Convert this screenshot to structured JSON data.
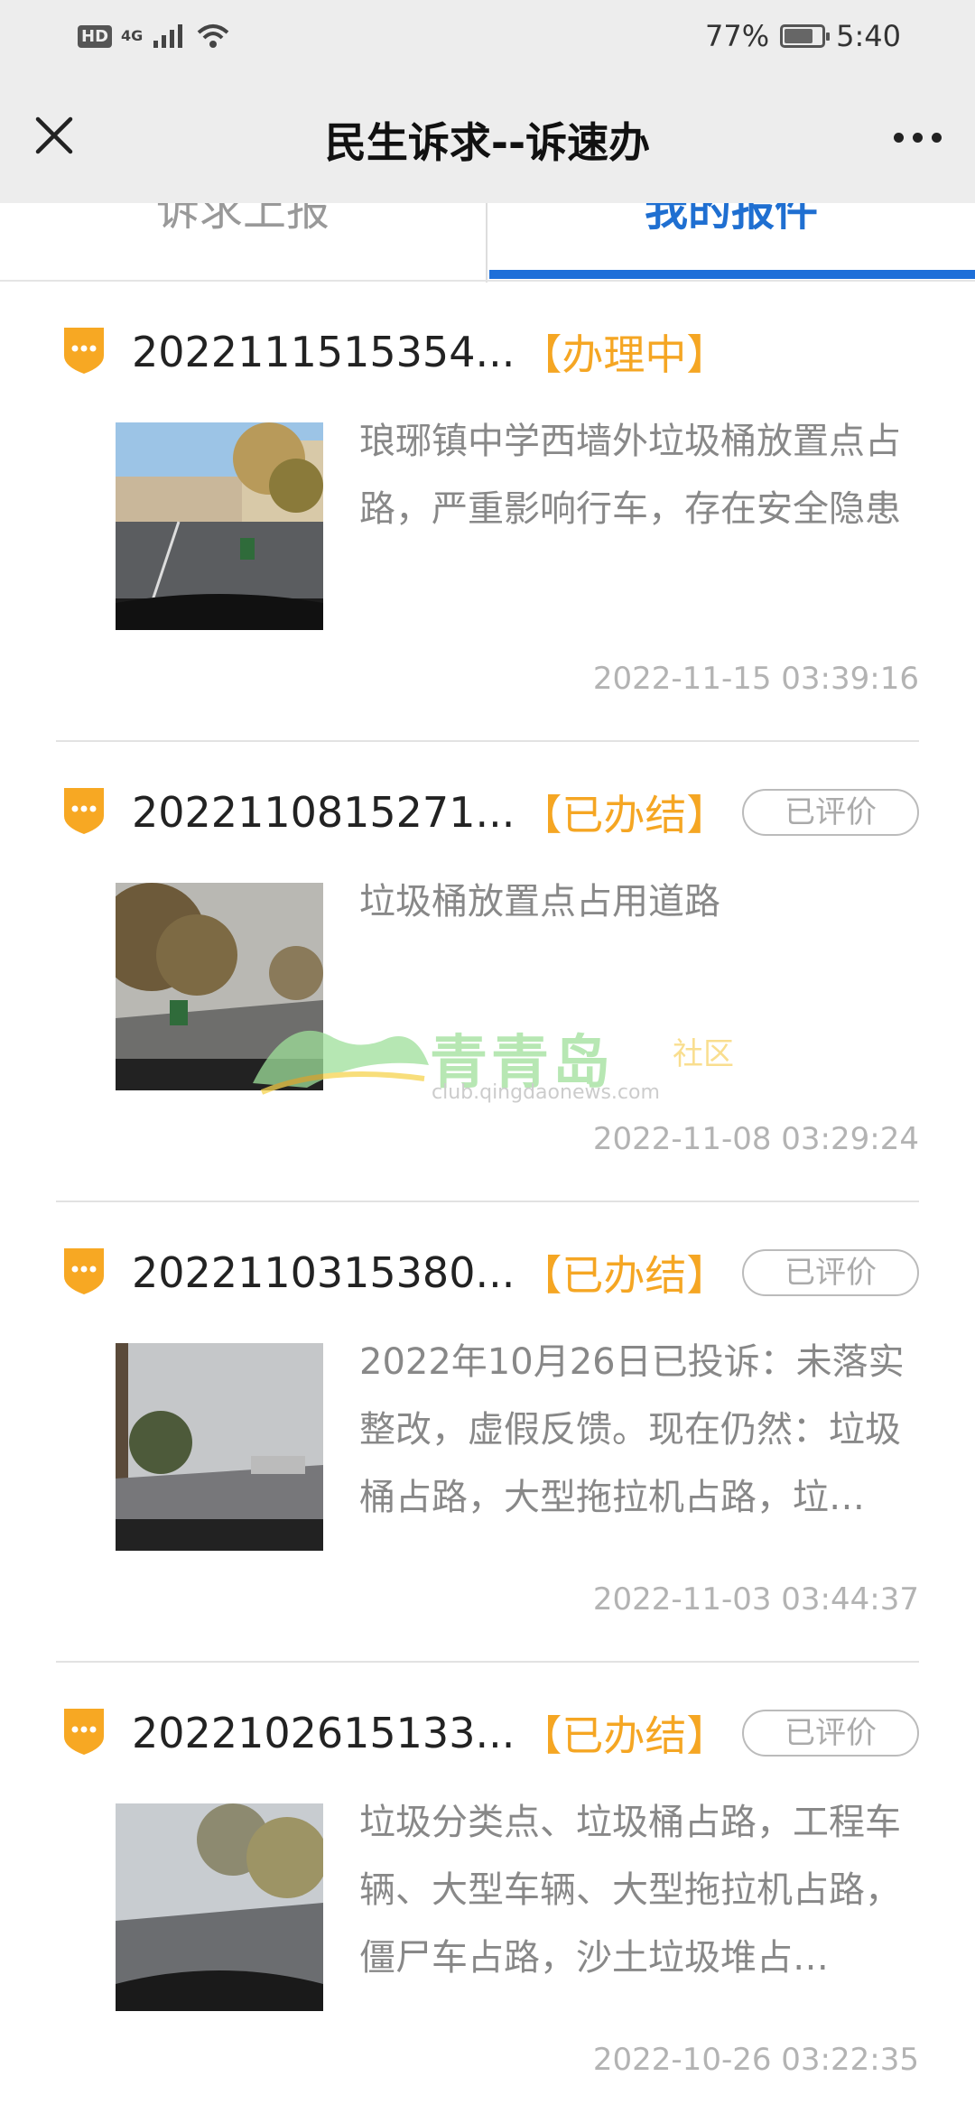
{
  "status_bar": {
    "hd": "HD",
    "network": "4G",
    "battery": "77%",
    "battery_level": 0.77,
    "time": "5:40"
  },
  "title_bar": {
    "title": "民生诉求--诉速办",
    "close_icon": "close-icon",
    "more_icon": "more-icon"
  },
  "tabs": [
    {
      "label": "诉求上报",
      "selected": false
    },
    {
      "label": "我的报件",
      "selected": true
    }
  ],
  "accent_color": "#1e6fd9",
  "status_color": "#f5a623",
  "cases": [
    {
      "order_no": "2022111515354...",
      "status": "【办理中】",
      "evaluated": "",
      "description": "琅琊镇中学西墙外垃圾桶放置点占路，严重影响行车，存在安全隐患",
      "time": "2022-11-15 03:39:16"
    },
    {
      "order_no": "2022110815271...",
      "status": "【已办结】",
      "evaluated": "已评价",
      "description": "垃圾桶放置点占用道路",
      "time": "2022-11-08 03:29:24"
    },
    {
      "order_no": "2022110315380...",
      "status": "【已办结】",
      "evaluated": "已评价",
      "description": "2022年10月26日已投诉：未落实整改，虚假反馈。现在仍然：垃圾桶占路，大型拖拉机占路，垃…",
      "time": "2022-11-03 03:44:37"
    },
    {
      "order_no": "2022102615133...",
      "status": "【已办结】",
      "evaluated": "已评价",
      "description": "垃圾分类点、垃圾桶占路，工程车辆、大型车辆、大型拖拉机占路，僵尸车占路，沙土垃圾堆占…",
      "time": "2022-10-26 03:22:35"
    }
  ],
  "watermark": {
    "main": "青青岛",
    "sub": "社区",
    "url": "club.qingdaonews.com"
  }
}
